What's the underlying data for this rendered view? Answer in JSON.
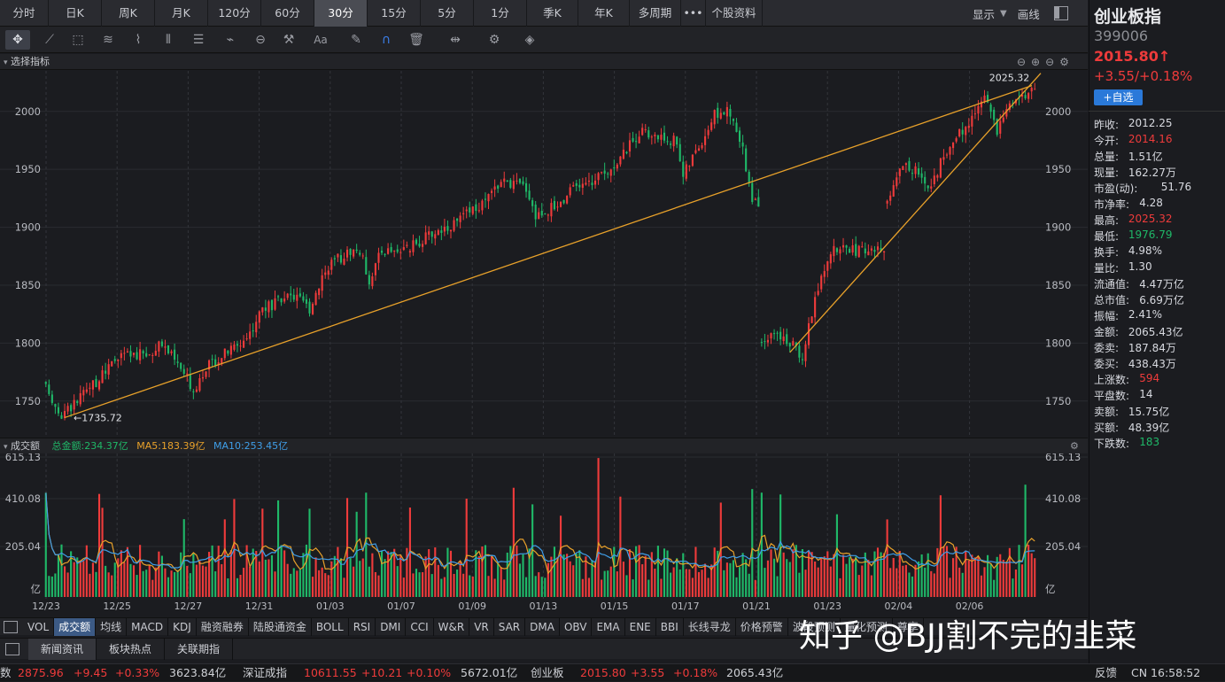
{
  "periods": [
    "分时",
    "日K",
    "周K",
    "月K",
    "120分",
    "60分",
    "30分",
    "15分",
    "5分",
    "1分",
    "季K",
    "年K",
    "多周期",
    "•••",
    "个股资料"
  ],
  "active_period": "30分",
  "topright": {
    "display": "显示",
    "draw": "画线"
  },
  "panel_title": "选择指标",
  "stock": {
    "name": "创业板指",
    "code": "399006",
    "price": "2015.80↑",
    "change": "+3.55/+0.18%",
    "add_btn": "+自选"
  },
  "quote": [
    {
      "k": "昨收:",
      "v": "2012.25",
      "c": "#d8dae0"
    },
    {
      "k": "今开:",
      "v": "2014.16",
      "c": "#ee3b3b"
    },
    {
      "k": "总量:",
      "v": "1.51亿",
      "c": "#d8dae0"
    },
    {
      "k": "现量:",
      "v": "162.27万",
      "c": "#d8dae0"
    },
    {
      "k": "市盈(动):",
      "v": "51.76",
      "c": "#d8dae0"
    },
    {
      "k": "市净率:",
      "v": "4.28",
      "c": "#d8dae0"
    },
    {
      "k": "最高:",
      "v": "2025.32",
      "c": "#ee3b3b"
    },
    {
      "k": "最低:",
      "v": "1976.79",
      "c": "#1fb868"
    },
    {
      "k": "换手:",
      "v": "4.98%",
      "c": "#d8dae0"
    },
    {
      "k": "量比:",
      "v": "1.30",
      "c": "#d8dae0"
    },
    {
      "k": "流通值:",
      "v": "4.47万亿",
      "c": "#d8dae0"
    },
    {
      "k": "总市值:",
      "v": "6.69万亿",
      "c": "#d8dae0"
    },
    {
      "k": "振幅:",
      "v": "2.41%",
      "c": "#d8dae0"
    },
    {
      "k": "金额:",
      "v": "2065.43亿",
      "c": "#d8dae0"
    },
    {
      "k": "委卖:",
      "v": "187.84万",
      "c": "#d8dae0"
    },
    {
      "k": "委买:",
      "v": "438.43万",
      "c": "#d8dae0"
    },
    {
      "k": "上涨数:",
      "v": "594",
      "c": "#ee3b3b"
    },
    {
      "k": "平盘数:",
      "v": "14",
      "c": "#d8dae0"
    },
    {
      "k": "卖额:",
      "v": "15.75亿",
      "c": "#d8dae0"
    },
    {
      "k": "买额:",
      "v": "48.39亿",
      "c": "#d8dae0"
    },
    {
      "k": "下跌数:",
      "v": "183",
      "c": "#1fb868"
    }
  ],
  "volume_header": {
    "title": "成交额",
    "total": "总金额:234.37亿",
    "ma5": "MA5:183.39亿",
    "ma10": "MA10:253.45亿"
  },
  "indicator_tabs": [
    "VOL",
    "成交额",
    "均线",
    "MACD",
    "KDJ",
    "融资融券",
    "陆股通资金",
    "BOLL",
    "RSI",
    "DMI",
    "CCI",
    "W&R",
    "VR",
    "SAR",
    "DMA",
    "OBV",
    "EMA",
    "ENE",
    "BBI",
    "长线寻龙",
    "价格预警",
    "波段预测",
    "量化预测",
    "尊享"
  ],
  "active_indicator": "成交额",
  "news_tabs": [
    "新闻资讯",
    "板块热点",
    "关联期指"
  ],
  "status": {
    "s1_name": "数",
    "s1_price": "2875.96",
    "s1_chg": "+9.45",
    "s1_pct": "+0.33%",
    "s1_amt": "3623.84亿",
    "s2_name": "深证成指",
    "s2_price": "10611.55",
    "s2_chg": "+10.21",
    "s2_pct": "+0.10%",
    "s2_amt": "5672.01亿",
    "s3_name": "创业板",
    "s3_price": "2015.80",
    "s3_chg": "+3.55",
    "s3_pct": "+0.18%",
    "s3_amt": "2065.43亿",
    "feedback": "反馈",
    "clock": "CN 16:58:52"
  },
  "watermark": "知乎 @BJJ割不完的韭菜",
  "chart_data": {
    "type": "candlestick",
    "interval": "30min",
    "price_ylim": [
      1720,
      2035
    ],
    "price_ticks": [
      1750,
      1800,
      1850,
      1900,
      1950,
      2000
    ],
    "volume_ticks_labels": [
      "615.13",
      "410.08",
      "205.04",
      "亿"
    ],
    "volume_ylim": [
      0,
      615.13
    ],
    "x_labels": [
      "12/23",
      "12/25",
      "12/27",
      "12/31",
      "01/03",
      "01/07",
      "01/09",
      "01/13",
      "01/15",
      "01/17",
      "01/21",
      "01/23",
      "02/04",
      "02/06"
    ],
    "annotations": [
      {
        "text": "2025.32",
        "value": 2025.32,
        "kind": "max"
      },
      {
        "text": "1735.72",
        "value": 1735.72,
        "kind": "min"
      }
    ],
    "trendlines": [
      {
        "from": [
          0,
          1735
        ],
        "to": [
          1,
          2025
        ]
      },
      {
        "from": [
          2,
          1770
        ],
        "to": [
          3,
          2020
        ]
      }
    ],
    "candle_seed": 17,
    "segments": [
      {
        "from_time": "12/23",
        "n": 60,
        "start": 1765,
        "path": [
          [
            0,
            1765
          ],
          [
            6,
            1738
          ],
          [
            15,
            1760
          ],
          [
            25,
            1790
          ],
          [
            35,
            1790
          ],
          [
            38,
            1800
          ],
          [
            46,
            1770
          ],
          [
            48,
            1760
          ],
          [
            52,
            1780
          ],
          [
            60,
            1795
          ]
        ]
      },
      {
        "from_time": "12/31",
        "n": 56,
        "start": 1795,
        "path": [
          [
            0,
            1795
          ],
          [
            5,
            1805
          ],
          [
            10,
            1830
          ],
          [
            20,
            1840
          ],
          [
            25,
            1830
          ],
          [
            30,
            1865
          ],
          [
            38,
            1880
          ],
          [
            41,
            1880
          ],
          [
            44,
            1855
          ],
          [
            48,
            1880
          ],
          [
            55,
            1880
          ]
        ]
      },
      {
        "from_time": "01/09",
        "n": 60,
        "start": 1880,
        "path": [
          [
            0,
            1880
          ],
          [
            8,
            1895
          ],
          [
            16,
            1905
          ],
          [
            24,
            1920
          ],
          [
            30,
            1940
          ],
          [
            38,
            1935
          ],
          [
            41,
            1910
          ],
          [
            48,
            1920
          ],
          [
            54,
            1935
          ],
          [
            60,
            1940
          ]
        ]
      },
      {
        "from_time": "01/17",
        "n": 52,
        "start": 1940,
        "path": [
          [
            0,
            1940
          ],
          [
            8,
            1960
          ],
          [
            14,
            1982
          ],
          [
            20,
            1978
          ],
          [
            26,
            1975
          ],
          [
            28,
            1945
          ],
          [
            34,
            1975
          ],
          [
            38,
            1998
          ],
          [
            42,
            2000
          ],
          [
            44,
            1990
          ],
          [
            47,
            1965
          ],
          [
            50,
            1925
          ],
          [
            52,
            1920
          ]
        ]
      },
      {
        "from_time": "01/23",
        "n": 40,
        "start": 1800,
        "path": [
          [
            0,
            1800
          ],
          [
            4,
            1810
          ],
          [
            10,
            1800
          ],
          [
            14,
            1790
          ],
          [
            18,
            1840
          ],
          [
            24,
            1880
          ],
          [
            26,
            1880
          ]
        ]
      },
      {
        "from_time": "02/04",
        "n": 48,
        "start": 1920,
        "path": [
          [
            0,
            1920
          ],
          [
            6,
            1955
          ],
          [
            10,
            1950
          ],
          [
            14,
            1930
          ],
          [
            18,
            1955
          ],
          [
            22,
            1975
          ],
          [
            28,
            1995
          ],
          [
            32,
            2018
          ],
          [
            36,
            1980
          ],
          [
            40,
            2010
          ],
          [
            46,
            2016
          ]
        ]
      }
    ]
  }
}
